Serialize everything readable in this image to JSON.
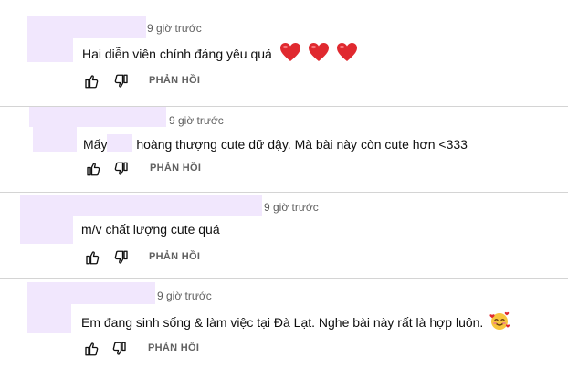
{
  "comments": [
    {
      "time": "9 giờ trước",
      "text": "Hai diễn viên chính đáng yêu quá",
      "emoji": "heart-emoji x3",
      "reply_label": "PHẢN HỒI"
    },
    {
      "time": "9 giờ trước",
      "text_before": "Mấy",
      "text_after": "hoàng thượng cute dữ dậy. Mà bài này còn cute hơn <333",
      "reply_label": "PHẢN HỒI"
    },
    {
      "time": "9 giờ trước",
      "text": "m/v chất lượng cute quá",
      "reply_label": "PHẢN HỒI"
    },
    {
      "time": "9 giờ trước",
      "text": "Em đang sinh sống & làm việc tại Đà Lạt. Nghe bài này rất là hợp luôn.",
      "emoji": "smiling-face-with-hearts-emoji",
      "reply_label": "PHẢN HỒI"
    }
  ],
  "colors": {
    "redaction": "#f1e7fd",
    "heart": "#e0292f",
    "secondary_text": "#606060",
    "divider": "#d4d4d4"
  }
}
